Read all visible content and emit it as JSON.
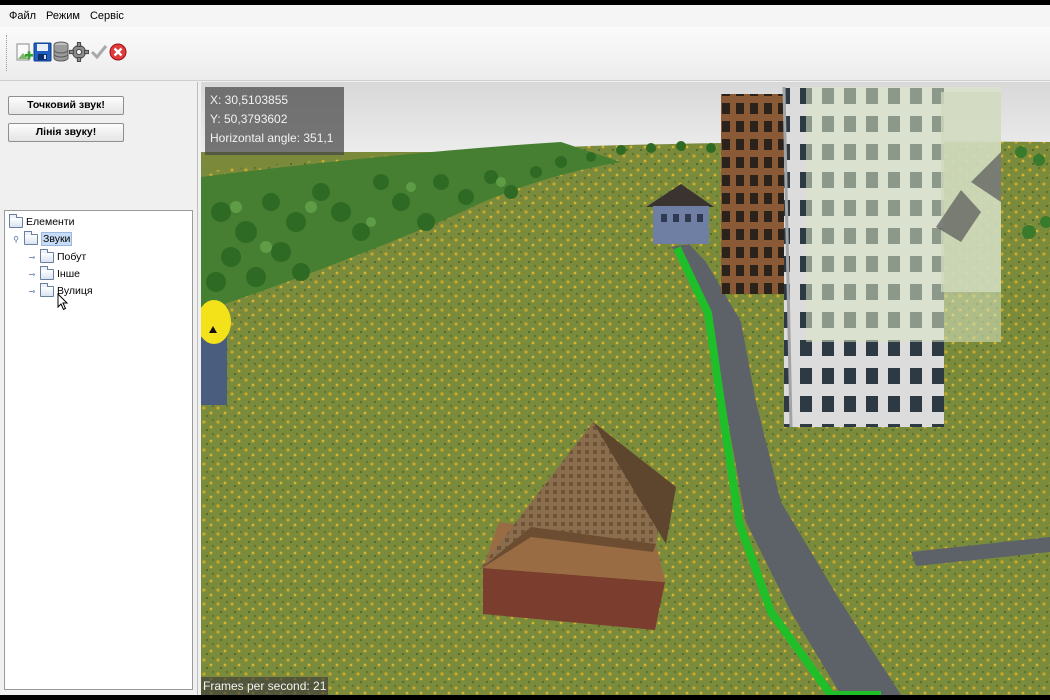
{
  "menu": {
    "file": "Файл",
    "mode": "Режим",
    "service": "Сервіс"
  },
  "toolbar": {
    "icons": [
      "add-icon",
      "save-icon",
      "database-icon",
      "gear-icon",
      "check-icon",
      "cancel-icon"
    ]
  },
  "left_panel": {
    "point_sound_button": "Точковий звук!",
    "sound_line_button": "Лінія звуку!",
    "tree": {
      "root": "Елементи",
      "sounds": "Звуки",
      "children": [
        "Побут",
        "Інше",
        "Вулиця"
      ]
    }
  },
  "viewport": {
    "hud": {
      "x": "X: 30,5103855",
      "y": "Y: 50,3793602",
      "angle": "Horizontal angle: 351,1"
    },
    "fps": "Frames per second: 21"
  },
  "colors": {
    "path": "#1fbf2a",
    "grass": "#7b8b3c",
    "sky": "#e4e4e4",
    "trees": "#3f7a2e"
  }
}
